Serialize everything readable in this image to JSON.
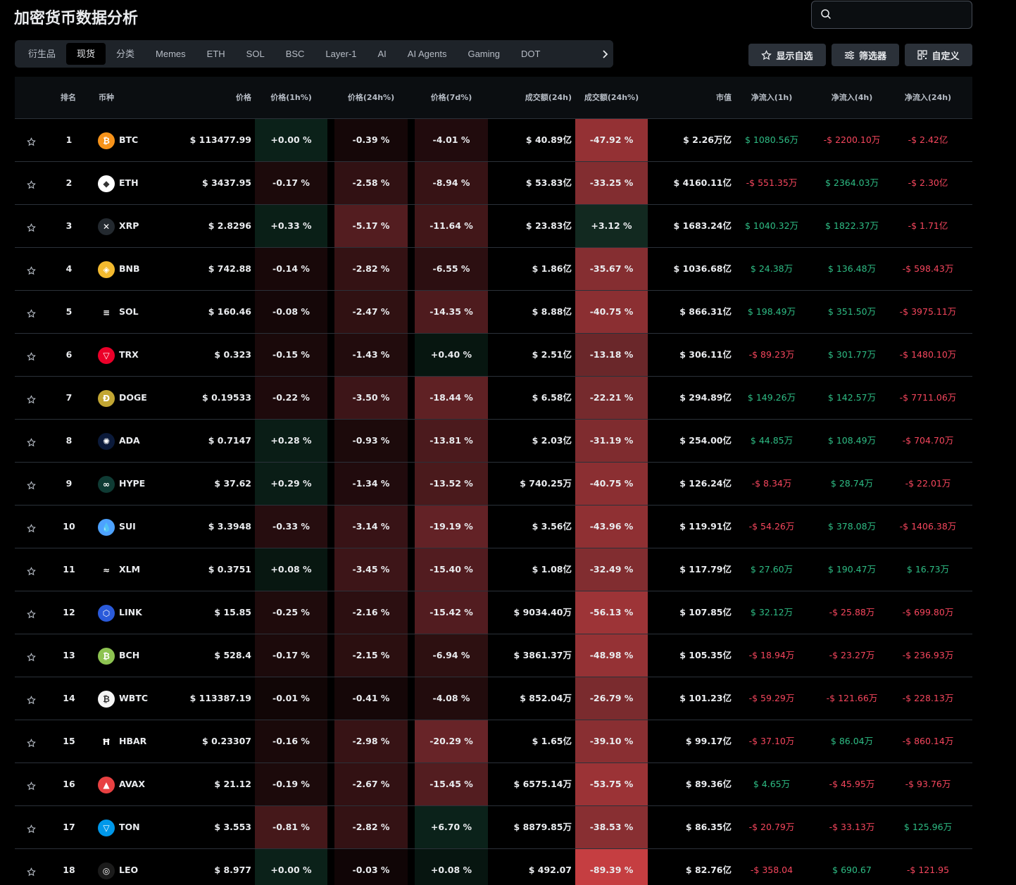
{
  "page": {
    "title": "加密货币数据分析"
  },
  "search": {
    "placeholder": ""
  },
  "tabs": [
    "衍生品",
    "现货",
    "分类",
    "Memes",
    "ETH",
    "SOL",
    "BSC",
    "Layer-1",
    "AI",
    "AI Agents",
    "Gaming",
    "DOT"
  ],
  "active_tab": 1,
  "toolbar": {
    "watchlist_label": "显示自选",
    "filter_label": "筛选器",
    "customize_label": "自定义"
  },
  "columns": {
    "rank": "排名",
    "coin": "币种",
    "price": "价格",
    "price_1h": "价格(1h%)",
    "price_24h": "价格(24h%)",
    "price_7d": "价格(7d%)",
    "volume_24h": "成交额(24h)",
    "volume_change_24h": "成交额(24h%)",
    "market_cap": "市值",
    "netflow_1h": "净流入(1h)",
    "netflow_4h": "净流入(4h)",
    "netflow_24h": "净流入(24h)"
  },
  "colors": {
    "positive": "#2ebd85",
    "negative": "#f6465d",
    "up_heat": "#0f2a22",
    "down_heat": "#7a2f33"
  },
  "rows": [
    {
      "rank": "1",
      "symbol": "BTC",
      "icon": "bitcoin-icon",
      "icon_color": "#f7931a",
      "icon_glyph": "₿",
      "price": "$ 113477.99",
      "p1h": "+0.00 %",
      "p24h": "-0.39 %",
      "p7d": "-4.01 %",
      "volume": "$ 40.89亿",
      "vol_chg": "-47.92 %",
      "mcap": "$ 2.26万亿",
      "f1h": "$ 1080.56万",
      "f4h": "-$ 2200.10万",
      "f24h": "-$ 2.42亿"
    },
    {
      "rank": "2",
      "symbol": "ETH",
      "icon": "ethereum-icon",
      "icon_color": "#ffffff",
      "icon_glyph": "◆",
      "price": "$ 3437.95",
      "p1h": "-0.17 %",
      "p24h": "-2.58 %",
      "p7d": "-8.94 %",
      "volume": "$ 53.83亿",
      "vol_chg": "-33.25 %",
      "mcap": "$ 4160.11亿",
      "f1h": "-$ 551.35万",
      "f4h": "$ 2364.03万",
      "f24h": "-$ 2.30亿"
    },
    {
      "rank": "3",
      "symbol": "XRP",
      "icon": "xrp-icon",
      "icon_color": "#23292f",
      "icon_glyph": "✕",
      "price": "$ 2.8296",
      "p1h": "+0.33 %",
      "p24h": "-5.17 %",
      "p7d": "-11.64 %",
      "volume": "$ 23.83亿",
      "vol_chg": "+3.12 %",
      "mcap": "$ 1683.24亿",
      "f1h": "$ 1040.32万",
      "f4h": "$ 1822.37万",
      "f24h": "-$ 1.71亿"
    },
    {
      "rank": "4",
      "symbol": "BNB",
      "icon": "bnb-icon",
      "icon_color": "#f3ba2f",
      "icon_glyph": "◈",
      "price": "$ 742.88",
      "p1h": "-0.14 %",
      "p24h": "-2.82 %",
      "p7d": "-6.55 %",
      "volume": "$ 1.86亿",
      "vol_chg": "-35.67 %",
      "mcap": "$ 1036.68亿",
      "f1h": "$ 24.38万",
      "f4h": "$ 136.48万",
      "f24h": "-$ 598.43万"
    },
    {
      "rank": "5",
      "symbol": "SOL",
      "icon": "solana-icon",
      "icon_color": "#000000",
      "icon_glyph": "≡",
      "price": "$ 160.46",
      "p1h": "-0.08 %",
      "p24h": "-2.47 %",
      "p7d": "-14.35 %",
      "volume": "$ 8.88亿",
      "vol_chg": "-40.75 %",
      "mcap": "$ 866.31亿",
      "f1h": "$ 198.49万",
      "f4h": "$ 351.50万",
      "f24h": "-$ 3975.11万"
    },
    {
      "rank": "6",
      "symbol": "TRX",
      "icon": "tron-icon",
      "icon_color": "#eb0029",
      "icon_glyph": "▽",
      "price": "$ 0.323",
      "p1h": "-0.15 %",
      "p24h": "-1.43 %",
      "p7d": "+0.40 %",
      "volume": "$ 2.51亿",
      "vol_chg": "-13.18 %",
      "mcap": "$ 306.11亿",
      "f1h": "-$ 89.23万",
      "f4h": "$ 301.77万",
      "f24h": "-$ 1480.10万"
    },
    {
      "rank": "7",
      "symbol": "DOGE",
      "icon": "dogecoin-icon",
      "icon_color": "#c2a633",
      "icon_glyph": "Ð",
      "price": "$ 0.19533",
      "p1h": "-0.22 %",
      "p24h": "-3.50 %",
      "p7d": "-18.44 %",
      "volume": "$ 6.58亿",
      "vol_chg": "-22.21 %",
      "mcap": "$ 294.89亿",
      "f1h": "$ 149.26万",
      "f4h": "$ 142.57万",
      "f24h": "-$ 7711.06万"
    },
    {
      "rank": "8",
      "symbol": "ADA",
      "icon": "cardano-icon",
      "icon_color": "#0b1a3a",
      "icon_glyph": "✺",
      "price": "$ 0.7147",
      "p1h": "+0.28 %",
      "p24h": "-0.93 %",
      "p7d": "-13.81 %",
      "volume": "$ 2.03亿",
      "vol_chg": "-31.19 %",
      "mcap": "$ 254.00亿",
      "f1h": "$ 44.85万",
      "f4h": "$ 108.49万",
      "f24h": "-$ 704.70万"
    },
    {
      "rank": "9",
      "symbol": "HYPE",
      "icon": "hyperliquid-icon",
      "icon_color": "#0f3b34",
      "icon_glyph": "∞",
      "price": "$ 37.62",
      "p1h": "+0.29 %",
      "p24h": "-1.34 %",
      "p7d": "-13.52 %",
      "volume": "$ 740.25万",
      "vol_chg": "-40.75 %",
      "mcap": "$ 126.24亿",
      "f1h": "-$ 8.34万",
      "f4h": "$ 28.74万",
      "f24h": "-$ 22.01万"
    },
    {
      "rank": "10",
      "symbol": "SUI",
      "icon": "sui-icon",
      "icon_color": "#4da2ff",
      "icon_glyph": "💧",
      "price": "$ 3.3948",
      "p1h": "-0.33 %",
      "p24h": "-3.14 %",
      "p7d": "-19.19 %",
      "volume": "$ 3.56亿",
      "vol_chg": "-43.96 %",
      "mcap": "$ 119.91亿",
      "f1h": "-$ 54.26万",
      "f4h": "$ 378.08万",
      "f24h": "-$ 1406.38万"
    },
    {
      "rank": "11",
      "symbol": "XLM",
      "icon": "stellar-icon",
      "icon_color": "#000000",
      "icon_glyph": "≈",
      "price": "$ 0.3751",
      "p1h": "+0.08 %",
      "p24h": "-3.45 %",
      "p7d": "-15.40 %",
      "volume": "$ 1.08亿",
      "vol_chg": "-32.49 %",
      "mcap": "$ 117.79亿",
      "f1h": "$ 27.60万",
      "f4h": "$ 190.47万",
      "f24h": "$ 16.73万"
    },
    {
      "rank": "12",
      "symbol": "LINK",
      "icon": "chainlink-icon",
      "icon_color": "#2a5ada",
      "icon_glyph": "⬡",
      "price": "$ 15.85",
      "p1h": "-0.25 %",
      "p24h": "-2.16 %",
      "p7d": "-15.42 %",
      "volume": "$ 9034.40万",
      "vol_chg": "-56.13 %",
      "mcap": "$ 107.85亿",
      "f1h": "$ 32.12万",
      "f4h": "-$ 25.88万",
      "f24h": "-$ 699.80万"
    },
    {
      "rank": "13",
      "symbol": "BCH",
      "icon": "bitcoin-cash-icon",
      "icon_color": "#8dc351",
      "icon_glyph": "₿",
      "price": "$ 528.4",
      "p1h": "-0.17 %",
      "p24h": "-2.15 %",
      "p7d": "-6.94 %",
      "volume": "$ 3861.37万",
      "vol_chg": "-48.98 %",
      "mcap": "$ 105.35亿",
      "f1h": "-$ 18.94万",
      "f4h": "-$ 23.27万",
      "f24h": "-$ 236.93万"
    },
    {
      "rank": "14",
      "symbol": "WBTC",
      "icon": "wrapped-bitcoin-icon",
      "icon_color": "#f5f5f5",
      "icon_glyph": "₿",
      "price": "$ 113387.19",
      "p1h": "-0.01 %",
      "p24h": "-0.41 %",
      "p7d": "-4.08 %",
      "volume": "$ 852.04万",
      "vol_chg": "-26.79 %",
      "mcap": "$ 101.23亿",
      "f1h": "-$ 59.29万",
      "f4h": "-$ 121.66万",
      "f24h": "-$ 228.13万"
    },
    {
      "rank": "15",
      "symbol": "HBAR",
      "icon": "hedera-icon",
      "icon_color": "#000000",
      "icon_glyph": "Ħ",
      "price": "$ 0.23307",
      "p1h": "-0.16 %",
      "p24h": "-2.98 %",
      "p7d": "-20.29 %",
      "volume": "$ 1.65亿",
      "vol_chg": "-39.10 %",
      "mcap": "$ 99.17亿",
      "f1h": "-$ 37.10万",
      "f4h": "$ 86.04万",
      "f24h": "-$ 860.14万"
    },
    {
      "rank": "16",
      "symbol": "AVAX",
      "icon": "avalanche-icon",
      "icon_color": "#e84142",
      "icon_glyph": "▲",
      "price": "$ 21.12",
      "p1h": "-0.19 %",
      "p24h": "-2.67 %",
      "p7d": "-15.45 %",
      "volume": "$ 6575.14万",
      "vol_chg": "-53.75 %",
      "mcap": "$ 89.36亿",
      "f1h": "$ 4.65万",
      "f4h": "-$ 45.95万",
      "f24h": "-$ 93.76万"
    },
    {
      "rank": "17",
      "symbol": "TON",
      "icon": "toncoin-icon",
      "icon_color": "#0098ea",
      "icon_glyph": "▽",
      "price": "$ 3.553",
      "p1h": "-0.81 %",
      "p24h": "-2.82 %",
      "p7d": "+6.70 %",
      "volume": "$ 8879.85万",
      "vol_chg": "-38.53 %",
      "mcap": "$ 86.35亿",
      "f1h": "-$ 20.79万",
      "f4h": "-$ 33.13万",
      "f24h": "$ 125.96万"
    },
    {
      "rank": "18",
      "symbol": "LEO",
      "icon": "unus-sed-leo-icon",
      "icon_color": "#1b1b1b",
      "icon_glyph": "◎",
      "price": "$ 8.977",
      "p1h": "+0.00 %",
      "p24h": "-0.03 %",
      "p7d": "+0.08 %",
      "volume": "$ 492.07",
      "vol_chg": "-89.39 %",
      "mcap": "$ 82.76亿",
      "f1h": "-$ 358.04",
      "f4h": "$ 690.67",
      "f24h": "-$ 121.95"
    }
  ]
}
